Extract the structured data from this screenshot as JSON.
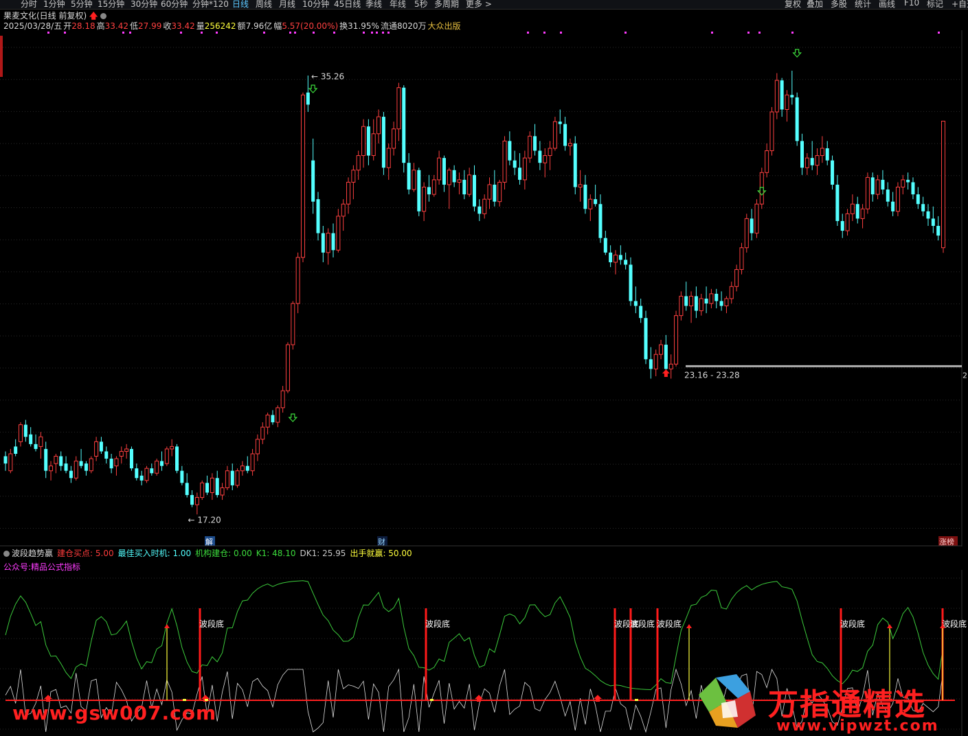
{
  "toolbar": {
    "periods": [
      "分时",
      "1分钟",
      "5分钟",
      "15分钟",
      "30分钟",
      "60分钟",
      "分钟*120",
      "日线",
      "周线",
      "月线",
      "10分钟",
      "45日线",
      "季线",
      "年线",
      "5秒",
      "多周期",
      "更多 >"
    ],
    "active": "日线",
    "right_items": [
      "复权",
      "叠加",
      "多股",
      "统计",
      "画线",
      "F10",
      "标记",
      "+自选"
    ]
  },
  "title": {
    "stock": "果麦文化(日线 前复权)"
  },
  "quote": {
    "date": "2025/03/28/五",
    "open_label": "开",
    "open": "28.18",
    "high_label": "高",
    "high": "33.42",
    "low_label": "低",
    "low": "27.99",
    "close_label": "收",
    "close": "33.42",
    "vol_label": "量",
    "vol": "256242",
    "amount_label": "额",
    "amount": "7.96亿",
    "change_label": "幅",
    "change": "5.57(20.00%)",
    "turnover_label": "换",
    "turnover": "31.95%",
    "float_label": "流通",
    "float": "8020万",
    "sector": "大众出版"
  },
  "colors": {
    "up": "#ff4040",
    "down": "#54ffff",
    "green": "#3cdc3c",
    "magenta": "#ff3cff",
    "yellow": "#ffff3c",
    "red_bar": "#ff1a1a",
    "ma_line": "#3ccc3c",
    "white_line": "#e0e0e0"
  },
  "annotations": {
    "high_label": "35.26",
    "low_label": "17.20",
    "range_label": "23.16 - 23.28",
    "jie": "解",
    "cai": "财",
    "zhangting": "涨榜",
    "axis_edge": "2"
  },
  "indicator": {
    "name": "波段趋势赢",
    "fields": [
      {
        "label": "建仓买点: ",
        "value": "5.00",
        "color": "#ff3c3c"
      },
      {
        "label": "最佳买入时机: ",
        "value": "1.00",
        "color": "#54ffff"
      },
      {
        "label": "机构建仓: ",
        "value": "0.00",
        "color": "#3cdc3c"
      },
      {
        "label": "K1: ",
        "value": "48.10",
        "color": "#3cdc3c"
      },
      {
        "label": "DK1: ",
        "value": "25.95",
        "color": "#c8c8c8"
      },
      {
        "label": "出手就赢: ",
        "value": "50.00",
        "color": "#ffff3c"
      }
    ],
    "subtitle": "公众号:精品公式指标",
    "label_bottom": "波段底"
  },
  "watermarks": {
    "left": "www.gsw007.com",
    "right": "万指通精选",
    "right_sub": "www.vipwzt.com"
  },
  "chart_data": {
    "type": "candlestick",
    "ylim": [
      16.5,
      37.0
    ],
    "ohlc": [
      [
        19.6,
        19.8,
        19.0,
        19.3
      ],
      [
        19.0,
        19.9,
        18.9,
        19.7
      ],
      [
        20.0,
        20.3,
        19.6,
        19.7
      ],
      [
        20.2,
        21.0,
        20.0,
        20.9
      ],
      [
        20.9,
        21.1,
        20.2,
        20.4
      ],
      [
        20.5,
        20.8,
        20.0,
        20.1
      ],
      [
        20.1,
        20.5,
        19.8,
        19.9
      ],
      [
        20.0,
        20.6,
        19.5,
        20.4
      ],
      [
        19.9,
        20.2,
        18.7,
        19.0
      ],
      [
        19.0,
        19.4,
        18.6,
        19.2
      ],
      [
        19.3,
        19.7,
        18.9,
        19.6
      ],
      [
        19.6,
        19.8,
        19.0,
        19.2
      ],
      [
        19.3,
        19.6,
        18.9,
        19.0
      ],
      [
        19.0,
        19.2,
        18.5,
        18.7
      ],
      [
        18.7,
        19.6,
        18.6,
        19.4
      ],
      [
        19.4,
        19.9,
        19.1,
        19.2
      ],
      [
        19.3,
        19.4,
        18.8,
        19.0
      ],
      [
        19.0,
        19.6,
        18.9,
        19.5
      ],
      [
        19.6,
        20.4,
        19.4,
        20.2
      ],
      [
        20.2,
        20.4,
        19.7,
        19.8
      ],
      [
        19.8,
        20.0,
        19.3,
        19.5
      ],
      [
        19.5,
        19.7,
        18.9,
        19.1
      ],
      [
        19.2,
        19.6,
        18.8,
        19.5
      ],
      [
        19.6,
        20.0,
        19.3,
        19.8
      ],
      [
        19.8,
        20.1,
        19.5,
        19.9
      ],
      [
        19.9,
        20.0,
        19.0,
        19.1
      ],
      [
        19.1,
        19.3,
        18.6,
        18.7
      ],
      [
        18.8,
        19.0,
        18.4,
        18.6
      ],
      [
        18.6,
        19.2,
        18.5,
        19.1
      ],
      [
        19.1,
        19.3,
        18.8,
        18.9
      ],
      [
        18.9,
        19.5,
        18.8,
        19.4
      ],
      [
        19.4,
        19.8,
        19.0,
        19.2
      ],
      [
        19.3,
        20.0,
        19.2,
        19.9
      ],
      [
        19.9,
        20.3,
        19.6,
        20.0
      ],
      [
        20.0,
        20.1,
        18.9,
        19.0
      ],
      [
        19.0,
        19.2,
        18.4,
        18.5
      ],
      [
        18.5,
        18.9,
        17.9,
        18.0
      ],
      [
        18.0,
        18.2,
        17.5,
        17.6
      ],
      [
        17.6,
        18.1,
        17.2,
        17.9
      ],
      [
        17.9,
        18.6,
        17.8,
        18.5
      ],
      [
        18.5,
        18.8,
        18.0,
        18.1
      ],
      [
        18.1,
        18.9,
        17.8,
        18.7
      ],
      [
        18.7,
        19.0,
        17.9,
        18.0
      ],
      [
        18.0,
        18.5,
        17.8,
        18.3
      ],
      [
        18.3,
        19.2,
        18.2,
        19.0
      ],
      [
        19.0,
        19.3,
        18.2,
        18.4
      ],
      [
        18.4,
        19.1,
        18.3,
        19.0
      ],
      [
        19.0,
        19.4,
        18.8,
        19.2
      ],
      [
        19.2,
        19.6,
        18.9,
        19.0
      ],
      [
        19.0,
        19.9,
        18.8,
        19.7
      ],
      [
        19.7,
        20.5,
        19.4,
        20.3
      ],
      [
        20.3,
        21.0,
        20.1,
        20.8
      ],
      [
        20.8,
        21.4,
        20.5,
        21.3
      ],
      [
        21.3,
        21.5,
        20.9,
        21.0
      ],
      [
        21.0,
        21.7,
        20.8,
        21.6
      ],
      [
        21.6,
        22.5,
        21.4,
        22.3
      ],
      [
        22.3,
        24.3,
        22.2,
        24.2
      ],
      [
        24.2,
        26.0,
        24.0,
        25.9
      ],
      [
        25.9,
        28.0,
        25.5,
        27.8
      ],
      [
        27.8,
        34.6,
        27.6,
        34.5
      ],
      [
        34.6,
        35.3,
        33.8,
        34.1
      ],
      [
        31.8,
        32.7,
        29.6,
        30.1
      ],
      [
        30.2,
        30.5,
        28.5,
        28.8
      ],
      [
        28.8,
        29.1,
        27.6,
        28.0
      ],
      [
        28.0,
        29.0,
        27.5,
        28.8
      ],
      [
        28.8,
        29.2,
        27.8,
        28.1
      ],
      [
        28.1,
        29.8,
        28.0,
        29.5
      ],
      [
        29.5,
        30.2,
        28.9,
        30.0
      ],
      [
        30.0,
        31.1,
        29.6,
        30.9
      ],
      [
        30.9,
        31.6,
        30.2,
        31.4
      ],
      [
        31.4,
        32.2,
        31.0,
        32.0
      ],
      [
        32.0,
        33.5,
        31.5,
        33.2
      ],
      [
        33.2,
        33.5,
        31.6,
        32.0
      ],
      [
        32.0,
        33.5,
        31.8,
        32.9
      ],
      [
        32.9,
        33.9,
        32.5,
        33.6
      ],
      [
        33.6,
        33.8,
        31.2,
        31.5
      ],
      [
        31.5,
        32.5,
        31.0,
        32.3
      ],
      [
        32.3,
        33.4,
        32.0,
        33.1
      ],
      [
        33.1,
        35.0,
        32.6,
        34.8
      ],
      [
        34.8,
        34.9,
        31.3,
        31.7
      ],
      [
        31.7,
        32.1,
        30.4,
        30.6
      ],
      [
        30.6,
        31.7,
        30.5,
        31.4
      ],
      [
        31.4,
        31.5,
        29.5,
        29.7
      ],
      [
        29.7,
        30.9,
        29.3,
        30.7
      ],
      [
        30.7,
        31.2,
        30.1,
        30.4
      ],
      [
        30.4,
        31.2,
        30.3,
        31.0
      ],
      [
        31.0,
        32.2,
        30.8,
        31.9
      ],
      [
        31.9,
        32.0,
        30.5,
        30.8
      ],
      [
        30.8,
        31.5,
        29.8,
        31.4
      ],
      [
        31.4,
        31.6,
        30.7,
        30.9
      ],
      [
        30.9,
        31.3,
        30.4,
        31.0
      ],
      [
        31.0,
        31.4,
        30.2,
        30.4
      ],
      [
        30.4,
        31.5,
        30.3,
        31.2
      ],
      [
        31.2,
        31.6,
        29.7,
        29.9
      ],
      [
        29.9,
        30.2,
        29.3,
        29.6
      ],
      [
        29.6,
        30.4,
        29.4,
        30.2
      ],
      [
        30.2,
        31.1,
        29.8,
        30.8
      ],
      [
        30.8,
        31.4,
        29.9,
        30.1
      ],
      [
        30.1,
        31.0,
        29.9,
        30.9
      ],
      [
        30.9,
        32.8,
        30.6,
        32.6
      ],
      [
        32.6,
        33.0,
        31.6,
        31.8
      ],
      [
        31.8,
        32.2,
        31.2,
        31.5
      ],
      [
        31.5,
        32.1,
        30.8,
        31.0
      ],
      [
        31.0,
        32.2,
        30.6,
        31.9
      ],
      [
        31.9,
        33.0,
        31.7,
        32.8
      ],
      [
        32.8,
        33.3,
        32.0,
        32.2
      ],
      [
        32.2,
        32.6,
        31.4,
        31.7
      ],
      [
        31.7,
        32.3,
        31.1,
        32.0
      ],
      [
        32.0,
        32.6,
        31.4,
        32.3
      ],
      [
        32.3,
        33.6,
        32.2,
        33.4
      ],
      [
        33.4,
        33.9,
        32.9,
        33.3
      ],
      [
        33.3,
        33.6,
        32.2,
        32.4
      ],
      [
        32.4,
        32.7,
        32.0,
        32.5
      ],
      [
        32.5,
        32.8,
        30.4,
        30.7
      ],
      [
        30.7,
        31.4,
        30.1,
        30.8
      ],
      [
        30.8,
        31.2,
        29.6,
        29.8
      ],
      [
        29.8,
        30.4,
        29.3,
        30.2
      ],
      [
        30.2,
        30.8,
        29.9,
        30.0
      ],
      [
        30.0,
        30.4,
        28.4,
        28.6
      ],
      [
        28.6,
        28.9,
        27.9,
        28.0
      ],
      [
        28.0,
        28.3,
        27.4,
        27.6
      ],
      [
        27.6,
        28.1,
        27.1,
        27.9
      ],
      [
        27.9,
        28.3,
        27.5,
        27.7
      ],
      [
        27.7,
        28.0,
        27.3,
        27.5
      ],
      [
        27.5,
        27.8,
        25.8,
        26.0
      ],
      [
        26.0,
        26.6,
        25.5,
        25.8
      ],
      [
        25.8,
        26.1,
        25.1,
        25.3
      ],
      [
        25.3,
        25.6,
        23.4,
        23.6
      ],
      [
        23.6,
        24.1,
        22.8,
        23.2
      ],
      [
        23.2,
        24.0,
        22.9,
        23.8
      ],
      [
        23.8,
        24.4,
        23.6,
        24.2
      ],
      [
        24.2,
        24.6,
        23.0,
        23.2
      ],
      [
        23.2,
        23.8,
        22.8,
        23.4
      ],
      [
        23.4,
        25.6,
        23.3,
        25.4
      ],
      [
        25.4,
        26.4,
        25.2,
        26.2
      ],
      [
        26.2,
        26.8,
        25.6,
        25.8
      ],
      [
        25.8,
        26.4,
        25.1,
        26.2
      ],
      [
        26.2,
        26.6,
        25.3,
        25.6
      ],
      [
        25.6,
        26.3,
        25.4,
        26.1
      ],
      [
        26.1,
        26.6,
        25.5,
        25.9
      ],
      [
        25.9,
        26.5,
        25.7,
        26.3
      ],
      [
        26.3,
        26.5,
        25.7,
        26.0
      ],
      [
        26.0,
        26.4,
        25.6,
        25.8
      ],
      [
        25.8,
        26.2,
        25.5,
        26.1
      ],
      [
        26.1,
        26.8,
        25.9,
        26.6
      ],
      [
        26.6,
        27.5,
        26.4,
        27.3
      ],
      [
        27.3,
        28.4,
        27.1,
        28.2
      ],
      [
        28.2,
        29.6,
        28.0,
        29.4
      ],
      [
        29.4,
        29.8,
        28.5,
        28.8
      ],
      [
        28.8,
        30.2,
        28.6,
        30.0
      ],
      [
        30.0,
        31.5,
        29.8,
        31.3
      ],
      [
        31.3,
        32.5,
        31.1,
        32.2
      ],
      [
        32.2,
        34.0,
        32.0,
        33.8
      ],
      [
        33.8,
        35.4,
        33.5,
        35.1
      ],
      [
        35.1,
        35.2,
        33.6,
        33.9
      ],
      [
        33.9,
        34.7,
        33.4,
        34.5
      ],
      [
        34.5,
        35.5,
        34.1,
        34.4
      ],
      [
        34.4,
        34.6,
        32.4,
        32.6
      ],
      [
        32.6,
        32.9,
        31.2,
        31.5
      ],
      [
        31.5,
        32.1,
        31.2,
        31.9
      ],
      [
        31.9,
        32.6,
        31.4,
        31.6
      ],
      [
        31.6,
        32.3,
        31.2,
        32.0
      ],
      [
        32.0,
        32.8,
        31.7,
        32.3
      ],
      [
        32.3,
        32.6,
        31.6,
        31.8
      ],
      [
        31.8,
        32.0,
        30.6,
        30.8
      ],
      [
        30.8,
        31.2,
        29.1,
        29.3
      ],
      [
        29.3,
        29.6,
        28.6,
        28.9
      ],
      [
        28.9,
        29.8,
        28.7,
        29.6
      ],
      [
        29.6,
        30.4,
        29.3,
        30.0
      ],
      [
        30.0,
        30.3,
        29.2,
        29.4
      ],
      [
        29.4,
        30.0,
        29.0,
        29.8
      ],
      [
        29.8,
        31.3,
        29.6,
        31.1
      ],
      [
        31.1,
        31.3,
        30.1,
        30.4
      ],
      [
        30.4,
        31.2,
        30.2,
        31.0
      ],
      [
        31.0,
        31.4,
        30.4,
        30.6
      ],
      [
        30.6,
        30.9,
        29.9,
        30.1
      ],
      [
        30.1,
        30.5,
        29.5,
        29.7
      ],
      [
        29.7,
        30.9,
        29.5,
        30.7
      ],
      [
        30.7,
        31.2,
        30.4,
        31.0
      ],
      [
        31.0,
        31.3,
        30.6,
        30.9
      ],
      [
        30.9,
        31.1,
        30.2,
        30.4
      ],
      [
        30.4,
        30.7,
        29.8,
        30.0
      ],
      [
        30.0,
        30.3,
        29.5,
        29.7
      ],
      [
        29.7,
        30.0,
        29.1,
        29.4
      ],
      [
        29.4,
        29.9,
        28.8,
        29.1
      ],
      [
        29.1,
        29.5,
        28.5,
        28.7
      ],
      [
        28.2,
        33.42,
        27.99,
        33.42
      ]
    ],
    "high_point": 35.26,
    "low_point": 17.2,
    "support_level": 23.2
  }
}
